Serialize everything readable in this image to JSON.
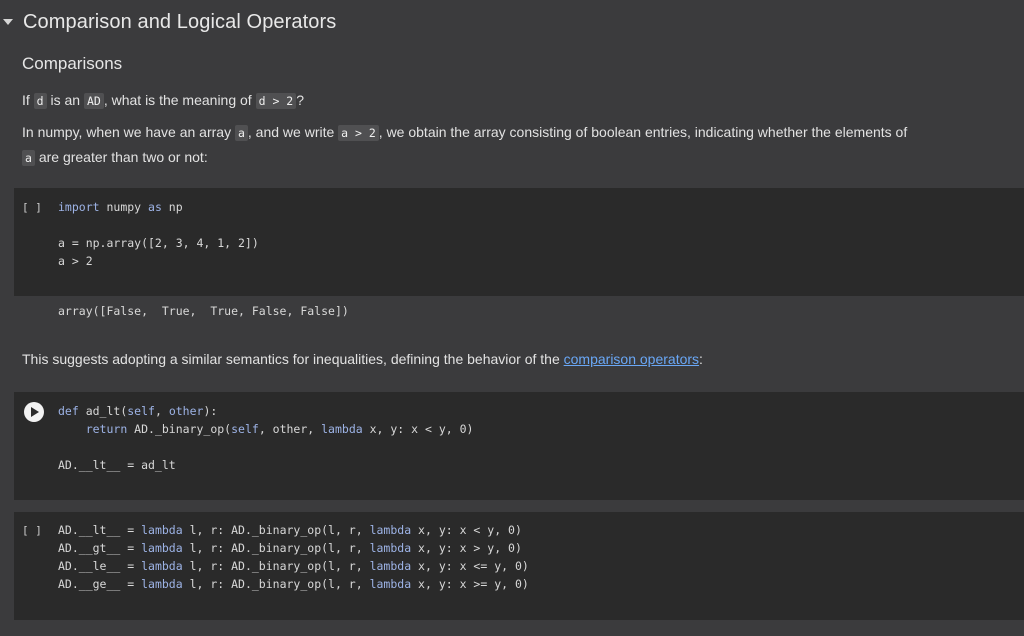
{
  "section": {
    "title": "Comparison and Logical Operators",
    "subtitle": "Comparisons"
  },
  "para1": {
    "t1": "If ",
    "c1": "d",
    "t2": " is an ",
    "c2": "AD",
    "t3": ", what is the meaning of ",
    "c3": "d > 2",
    "t4": "?"
  },
  "para2": {
    "t1": "In numpy, when we have an array ",
    "c1": "a",
    "t2": ", and we write ",
    "c2": "a > 2",
    "t3": ", we obtain the array consisting of boolean entries, indicating whether the elements of",
    "c3": "a",
    "t4": " are greater than two or not:"
  },
  "cell1": {
    "gutter": "[ ]",
    "line1_kw1": "import",
    "line1_mid": " numpy ",
    "line1_kw2": "as",
    "line1_end": " np",
    "line2": "a = np.array([2, 3, 4, 1, 2])",
    "line3": "a > 2",
    "output": "array([False,  True,  True, False, False])"
  },
  "para3": {
    "text": "This suggests adopting a similar semantics for inequalities, defining the behavior of the ",
    "link": "comparison operators",
    "end": ":"
  },
  "cell2": {
    "def_kw": "def",
    "def_name": " ad_lt(",
    "self1": "self",
    "comma1": ", ",
    "other": "other",
    "def_end": "):",
    "ret_kw": "return",
    "ret_mid": " AD._binary_op(",
    "self2": "self",
    "ret_mid2": ", other, ",
    "lambda_kw": "lambda",
    "ret_end": " x, y: x < y, 0)",
    "assign": "AD.__lt__ = ad_lt"
  },
  "cell3": {
    "gutter": "[ ]",
    "rows": [
      {
        "lhs": "AD.__lt__ = ",
        "lam": "lambda",
        "mid": " l, r: AD._binary_op(l, r, ",
        "lam2": "lambda",
        "end": " x, y: x < y, 0)"
      },
      {
        "lhs": "AD.__gt__ = ",
        "lam": "lambda",
        "mid": " l, r: AD._binary_op(l, r, ",
        "lam2": "lambda",
        "end": " x, y: x > y, 0)"
      },
      {
        "lhs": "AD.__le__ = ",
        "lam": "lambda",
        "mid": " l, r: AD._binary_op(l, r, ",
        "lam2": "lambda",
        "end": " x, y: x <= y, 0)"
      },
      {
        "lhs": "AD.__ge__ = ",
        "lam": "lambda",
        "mid": " l, r: AD._binary_op(l, r, ",
        "lam2": "lambda",
        "end": " x, y: x >= y, 0)"
      }
    ]
  }
}
